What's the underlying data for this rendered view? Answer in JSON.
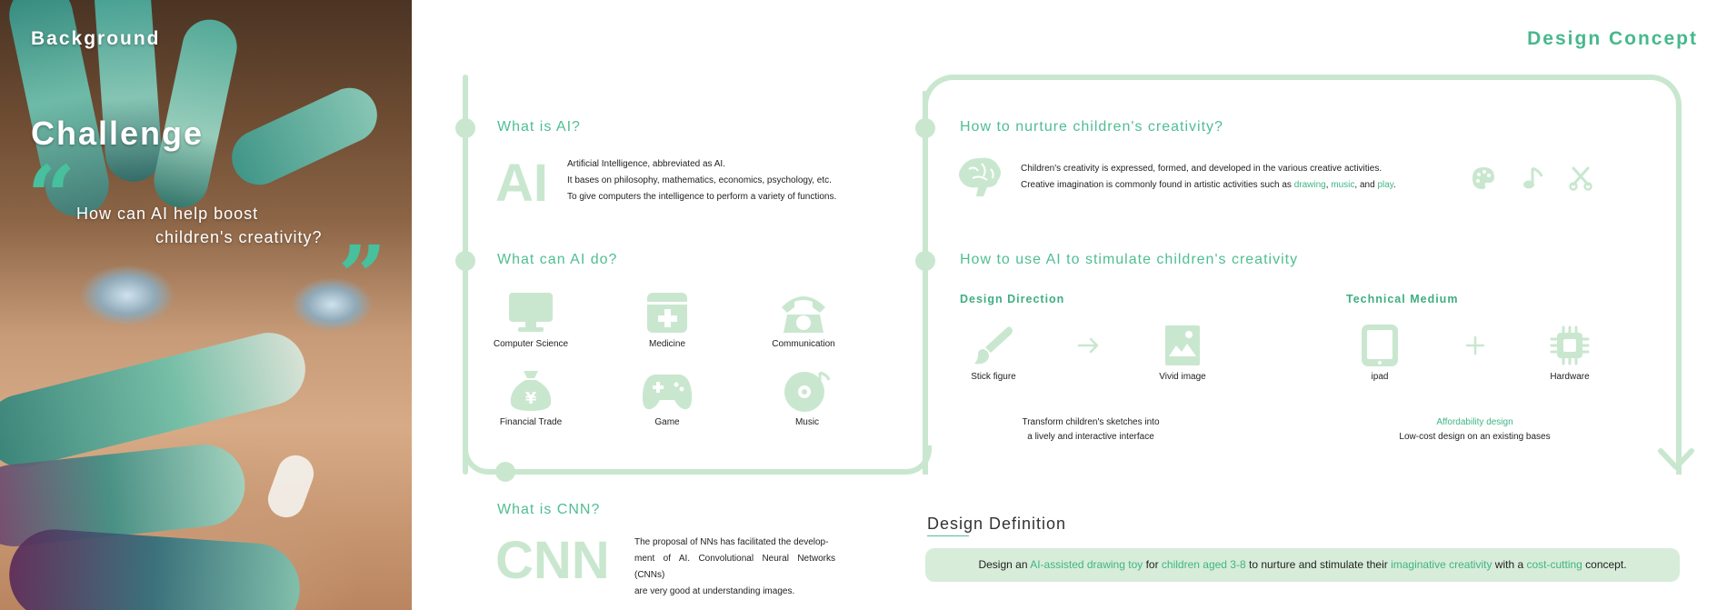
{
  "background": {
    "title": "Background",
    "challenge_title": "Challenge",
    "quote_line1": "How can AI help boost",
    "quote_line2": "children's creativity?",
    "quote_open": "“",
    "quote_close": "”"
  },
  "design_concept": {
    "title": "Design Concept"
  },
  "what_is_ai": {
    "title": "What is AI?",
    "big_word": "AI",
    "lines": [
      "Artificial Intelligence, abbreviated as AI.",
      "It bases on philosophy, mathematics, economics, psychology, etc.",
      "To give computers the intelligence to perform a variety of functions."
    ]
  },
  "what_can_ai_do": {
    "title": "What can AI do?",
    "items": [
      {
        "label": "Computer Science",
        "icon": "monitor-icon"
      },
      {
        "label": "Medicine",
        "icon": "medical-kit-icon"
      },
      {
        "label": "Communication",
        "icon": "telephone-icon"
      },
      {
        "label": "Financial Trade",
        "icon": "money-bag-icon"
      },
      {
        "label": "Game",
        "icon": "gamepad-icon"
      },
      {
        "label": "Music",
        "icon": "music-disc-icon"
      }
    ]
  },
  "what_is_cnn": {
    "title": "What is CNN?",
    "big_word": "CNN",
    "lines": [
      "The proposal of NNs has facilitated the develop-",
      "ment of AI. Convolutional Neural Networks (CNNs)",
      "are very good at understanding images."
    ]
  },
  "nurture": {
    "title": "How to nurture children's creativity?",
    "icon": "brain-icon",
    "line1": "Children's creativity is expressed, formed, and developed in the various creative activities.",
    "line2_prefix": "Creative imagination is commonly found in artistic activities such as ",
    "word_drawing": "drawing",
    "sep1": ", ",
    "word_music": "music",
    "sep2": ", and ",
    "word_play": "play",
    "line2_suffix": ".",
    "activity_icons": [
      "palette-icon",
      "music-note-icon",
      "scissors-icon"
    ]
  },
  "stimulate": {
    "title": "How to use AI to stimulate children's creativity",
    "design_direction": {
      "title": "Design Direction",
      "from_label": "Stick figure",
      "to_label": "Vivid image",
      "desc_line1": "Transform children's sketches into",
      "desc_line2": "a lively and interactive interface"
    },
    "technical_medium": {
      "title": "Technical Medium",
      "left_label": "ipad",
      "right_label": "Hardware",
      "highlight": "Affordability design",
      "desc": "Low-cost design on an existing bases"
    }
  },
  "design_definition": {
    "title": "Design Definition",
    "p1": "Design an ",
    "h1": "AI-assisted drawing toy",
    "p2": " for ",
    "h2": "children aged 3-8",
    "p3": " to nurture and stimulate their ",
    "h3": "imaginative creativity",
    "p4": " with a ",
    "h4": "cost-cutting",
    "p5": " concept."
  },
  "colors": {
    "accent": "#4fbe93",
    "accent_dark": "#3fae83",
    "frame": "#c9e7cf",
    "definition_box": "#d7ecd9",
    "quote_mark": "#47c09d"
  }
}
